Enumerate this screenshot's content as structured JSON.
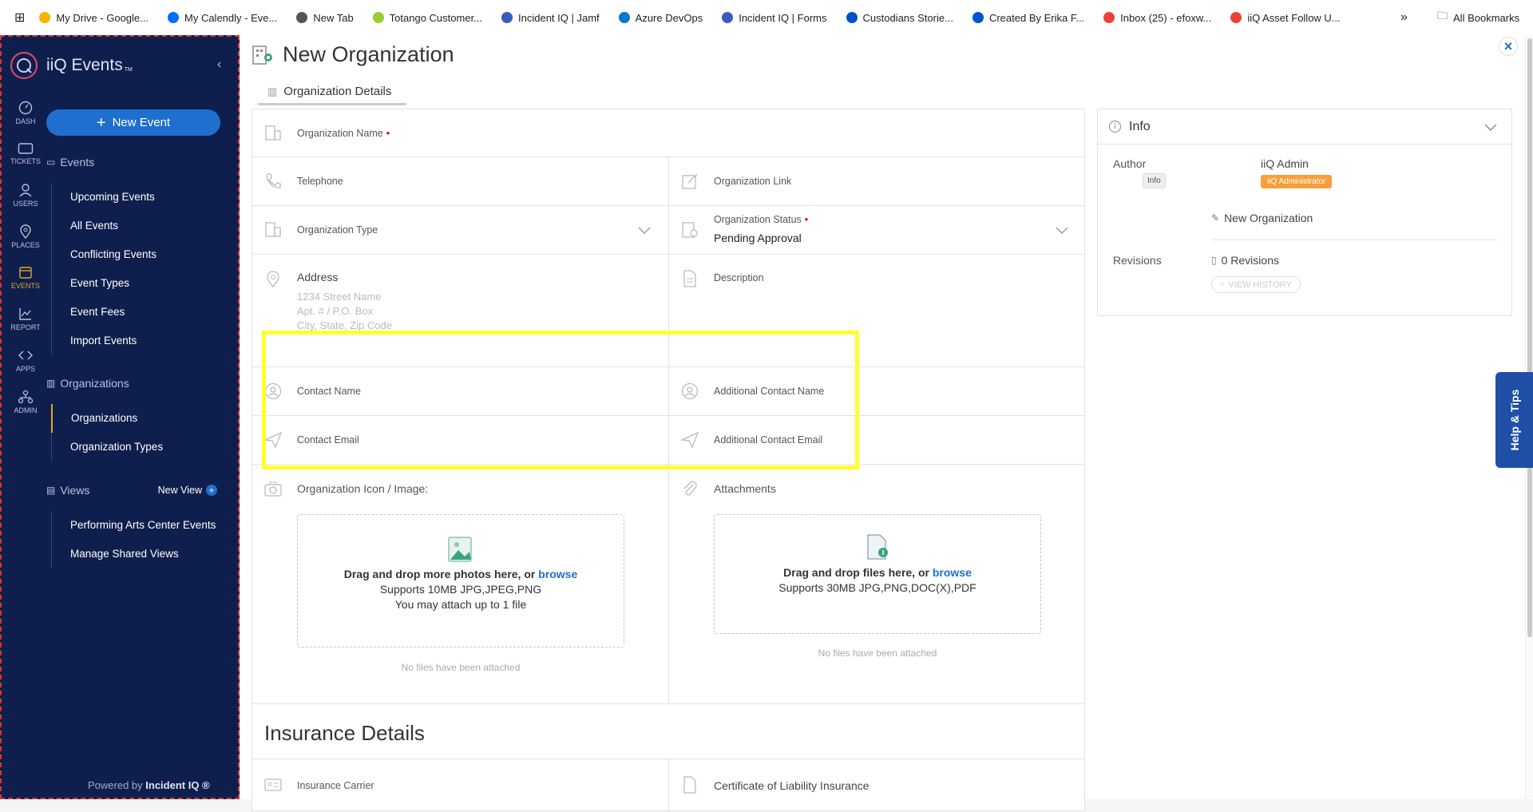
{
  "bookmarks": [
    {
      "label": "My Drive - Google...",
      "icon": "google-drive-icon",
      "color": "#f4b400"
    },
    {
      "label": "My Calendly - Eve...",
      "icon": "calendly-icon",
      "color": "#006bff"
    },
    {
      "label": "New Tab",
      "icon": "globe-icon",
      "color": "#555555"
    },
    {
      "label": "Totango Customer...",
      "icon": "totango-icon",
      "color": "#9acd32"
    },
    {
      "label": "Incident IQ | Jamf",
      "icon": "incidentiq-icon",
      "color": "#3a5bbf"
    },
    {
      "label": "Azure DevOps",
      "icon": "azure-devops-icon",
      "color": "#0078d4"
    },
    {
      "label": "Incident IQ | Forms",
      "icon": "incidentiq-icon",
      "color": "#3a5bbf"
    },
    {
      "label": "Custodians Storie...",
      "icon": "confluence-icon",
      "color": "#0052cc"
    },
    {
      "label": "Created By Erika F...",
      "icon": "confluence-icon",
      "color": "#0052cc"
    },
    {
      "label": "Inbox (25) - efoxw...",
      "icon": "gmail-icon",
      "color": "#ea4335"
    },
    {
      "label": "iiQ Asset Follow U...",
      "icon": "gmail-icon",
      "color": "#ea4335"
    }
  ],
  "all_bookmarks": "All Bookmarks",
  "overflow": "»",
  "sidebar": {
    "brand": "iiQ Events",
    "brand_tm": "TM",
    "rail": [
      "DASH",
      "TICKETS",
      "USERS",
      "PLACES",
      "EVENTS",
      "REPORT",
      "APPS",
      "ADMIN"
    ],
    "new_event": "New Event",
    "events_group": "Events",
    "events_items": [
      "Upcoming Events",
      "All Events",
      "Conflicting Events",
      "Event Types",
      "Event Fees",
      "Import Events"
    ],
    "orgs_group": "Organizations",
    "orgs_items": [
      "Organizations",
      "Organization Types"
    ],
    "views_group": "Views",
    "new_view": "New View",
    "views_items": [
      "Performing Arts Center Events",
      "Manage Shared Views"
    ],
    "powered_prefix": "Powered by ",
    "powered_brand": "Incident IQ ®"
  },
  "page": {
    "title": "New Organization",
    "tab": "Organization Details"
  },
  "form": {
    "org_name": "Organization Name",
    "telephone": "Telephone",
    "org_link": "Organization Link",
    "org_type": "Organization Type",
    "org_status_label": "Organization Status",
    "org_status_value": "Pending Approval",
    "address": "Address",
    "address_ph": [
      "1234 Street Name",
      "Apt. # / P.O. Box",
      "City, State, Zip Code"
    ],
    "description": "Description",
    "contact_name": "Contact Name",
    "additional_contact_name": "Additional Contact Name",
    "contact_email": "Contact Email",
    "additional_contact_email": "Additional Contact Email",
    "org_icon": "Organization Icon / Image:",
    "attachments": "Attachments",
    "photo_drop_text": "Drag and drop more photos here, or ",
    "browse": "browse",
    "photo_supports": "Supports 10MB JPG,JPEG,PNG",
    "photo_limit": "You may attach up to 1 file",
    "file_drop_text": "Drag and drop files here, or ",
    "file_supports": "Supports 30MB JPG,PNG,DOC(X),PDF",
    "no_files": "No files have been attached",
    "insurance_title": "Insurance Details",
    "insurance_carrier": "Insurance Carrier",
    "certificate": "Certificate of Liability Insurance"
  },
  "info": {
    "title": "Info",
    "author_label": "Author",
    "tooltip": "Info",
    "author_name": "iiQ Admin",
    "author_role": "iiQ Administrator",
    "new_org": "New Organization",
    "revisions_label": "Revisions",
    "revisions_value": "0 Revisions",
    "view_history": "VIEW HISTORY"
  },
  "help": "Help & Tips",
  "colors": {
    "sidebar": "#0f1f4d",
    "accent": "#1f6fce",
    "badge": "#f5a03a",
    "highlight": "#ffff2e",
    "required": "#d0021b"
  }
}
